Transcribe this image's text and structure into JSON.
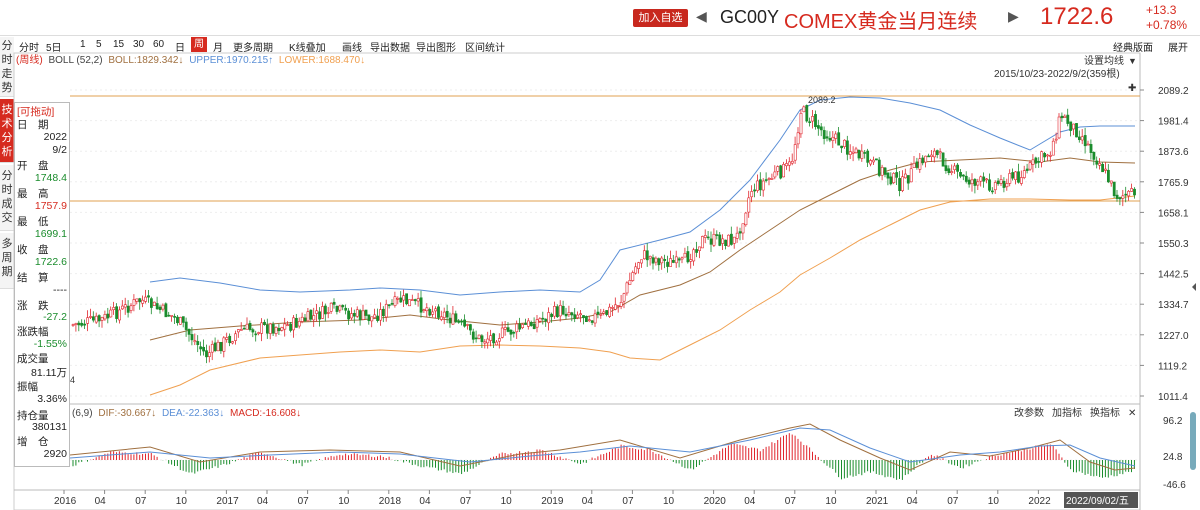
{
  "header": {
    "add_button": "加入自选",
    "code": "GC00Y",
    "name": "COMEX黄金当月连续",
    "price": "1722.6",
    "change": "+13.3",
    "change_pct": "+0.78%"
  },
  "toolbar": {
    "items": [
      "分时",
      "5日",
      "1",
      "5",
      "15",
      "30",
      "60",
      "日",
      "周",
      "月",
      "更多周期",
      "K线叠加",
      "画线",
      "导出数据",
      "导出图形",
      "区间统计"
    ],
    "right": [
      "经典版面",
      "展开"
    ],
    "active": "周"
  },
  "sidetabs": [
    "分时走势",
    "技术分析",
    "分时成交",
    "多周期"
  ],
  "info": {
    "title": "[可拖动]",
    "date_label": "日　期",
    "year": "2022",
    "date": "9/2",
    "open_label": "开　盘",
    "open": "1748.4",
    "high_label": "最　高",
    "high": "1757.9",
    "low_label": "最　低",
    "low": "1699.1",
    "close_label": "收　盘",
    "close": "1722.6",
    "settle_label": "结　算",
    "settle": "----",
    "chg_label": "涨　跌",
    "chg": "-27.2",
    "chgpct_label": "涨跌幅",
    "chgpct": "-1.55%",
    "vol_label": "成交量",
    "vol": "81.11万",
    "amp_label": "振幅",
    "amp": "3.36%",
    "oi_label": "持仓量",
    "oi": "380131",
    "oi_inc_label": "增　仓",
    "oi_inc": "2920"
  },
  "boll": {
    "period": "(周线)",
    "name": "BOLL (52,2)",
    "mid": "BOLL:1829.342↓",
    "upper": "UPPER:1970.215↑",
    "lower": "LOWER:1688.470↓"
  },
  "macd": {
    "params": "(6,9)",
    "dif": "DIF:-30.667↓",
    "dea": "DEA:-22.363↓",
    "macd": "MACD:-16.608↓"
  },
  "panel_right": {
    "setting": "设置均线",
    "range": "2015/10/23-2022/9/2(359根)",
    "change_params": "改参数",
    "add_indicator": "加指标",
    "change_indicator": "换指标"
  },
  "price_axis": [
    "2089.2",
    "1981.4",
    "1873.6",
    "1765.9",
    "1658.1",
    "1550.3",
    "1442.5",
    "1334.7",
    "1227.0",
    "1119.2",
    "1011.4"
  ],
  "macd_axis": [
    "96.2",
    "24.8",
    "-46.6"
  ],
  "x_axis": [
    "2016",
    "04",
    "07",
    "10",
    "2017",
    "04",
    "07",
    "10",
    "2018",
    "04",
    "07",
    "10",
    "2019",
    "04",
    "07",
    "10",
    "2020",
    "04",
    "07",
    "10",
    "2021",
    "04",
    "07",
    "10",
    "2022"
  ],
  "x_cursor": "2022/09/02/五",
  "peak_label": "2089.2",
  "small_label": "4",
  "colors": {
    "up": "#e0242c",
    "down": "#1a8c2c",
    "upper": "#5b8fd6",
    "mid": "#a07040",
    "lower": "#f0a050",
    "accent": "#d62a1f"
  }
}
